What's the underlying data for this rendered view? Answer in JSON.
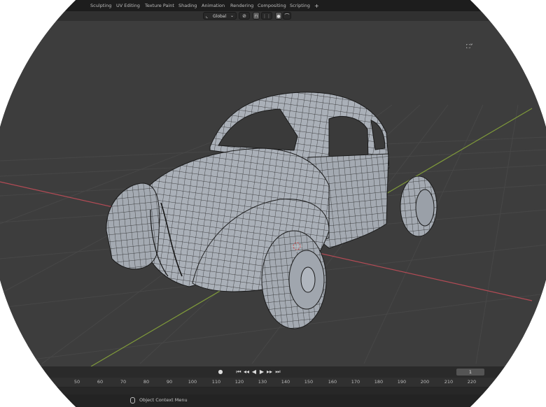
{
  "workspace_tabs": [
    "Sculpting",
    "UV Editing",
    "Texture Paint",
    "Shading",
    "Animation",
    "Rendering",
    "Compositing",
    "Scripting"
  ],
  "add_tab_symbol": "+",
  "header": {
    "orientation_label": "Global",
    "orientation_icon": "transform-orientation-icon",
    "pivot_icon": "pivot-point-icon",
    "snap_icon": "snap-icon",
    "snap_target_icon": "snap-increment-icon",
    "proportional_icon": "proportional-editing-icon",
    "falloff_icon": "falloff-curve-icon",
    "dropdown_symbol": "⌄"
  },
  "viewport": {
    "background": "#3d3d3d",
    "x_axis_color": "#b24b55",
    "y_axis_color": "#7f9a3a",
    "mesh_color": "#a9afb7",
    "wire_color": "#1c1c1c",
    "gizmo_toggle_symbol": "⛶˅"
  },
  "playback": {
    "record_symbol": "●",
    "controls": [
      "⏮",
      "◂◂",
      "◀",
      "▶",
      "▸▸",
      "⏭"
    ],
    "current_frame": "1"
  },
  "ruler_ticks": [
    "50",
    "60",
    "70",
    "80",
    "90",
    "100",
    "110",
    "120",
    "130",
    "140",
    "150",
    "160",
    "170",
    "180",
    "190",
    "200",
    "210",
    "220"
  ],
  "status": {
    "mouse_icon": "mouse-icon",
    "text": "Object Context Menu"
  }
}
